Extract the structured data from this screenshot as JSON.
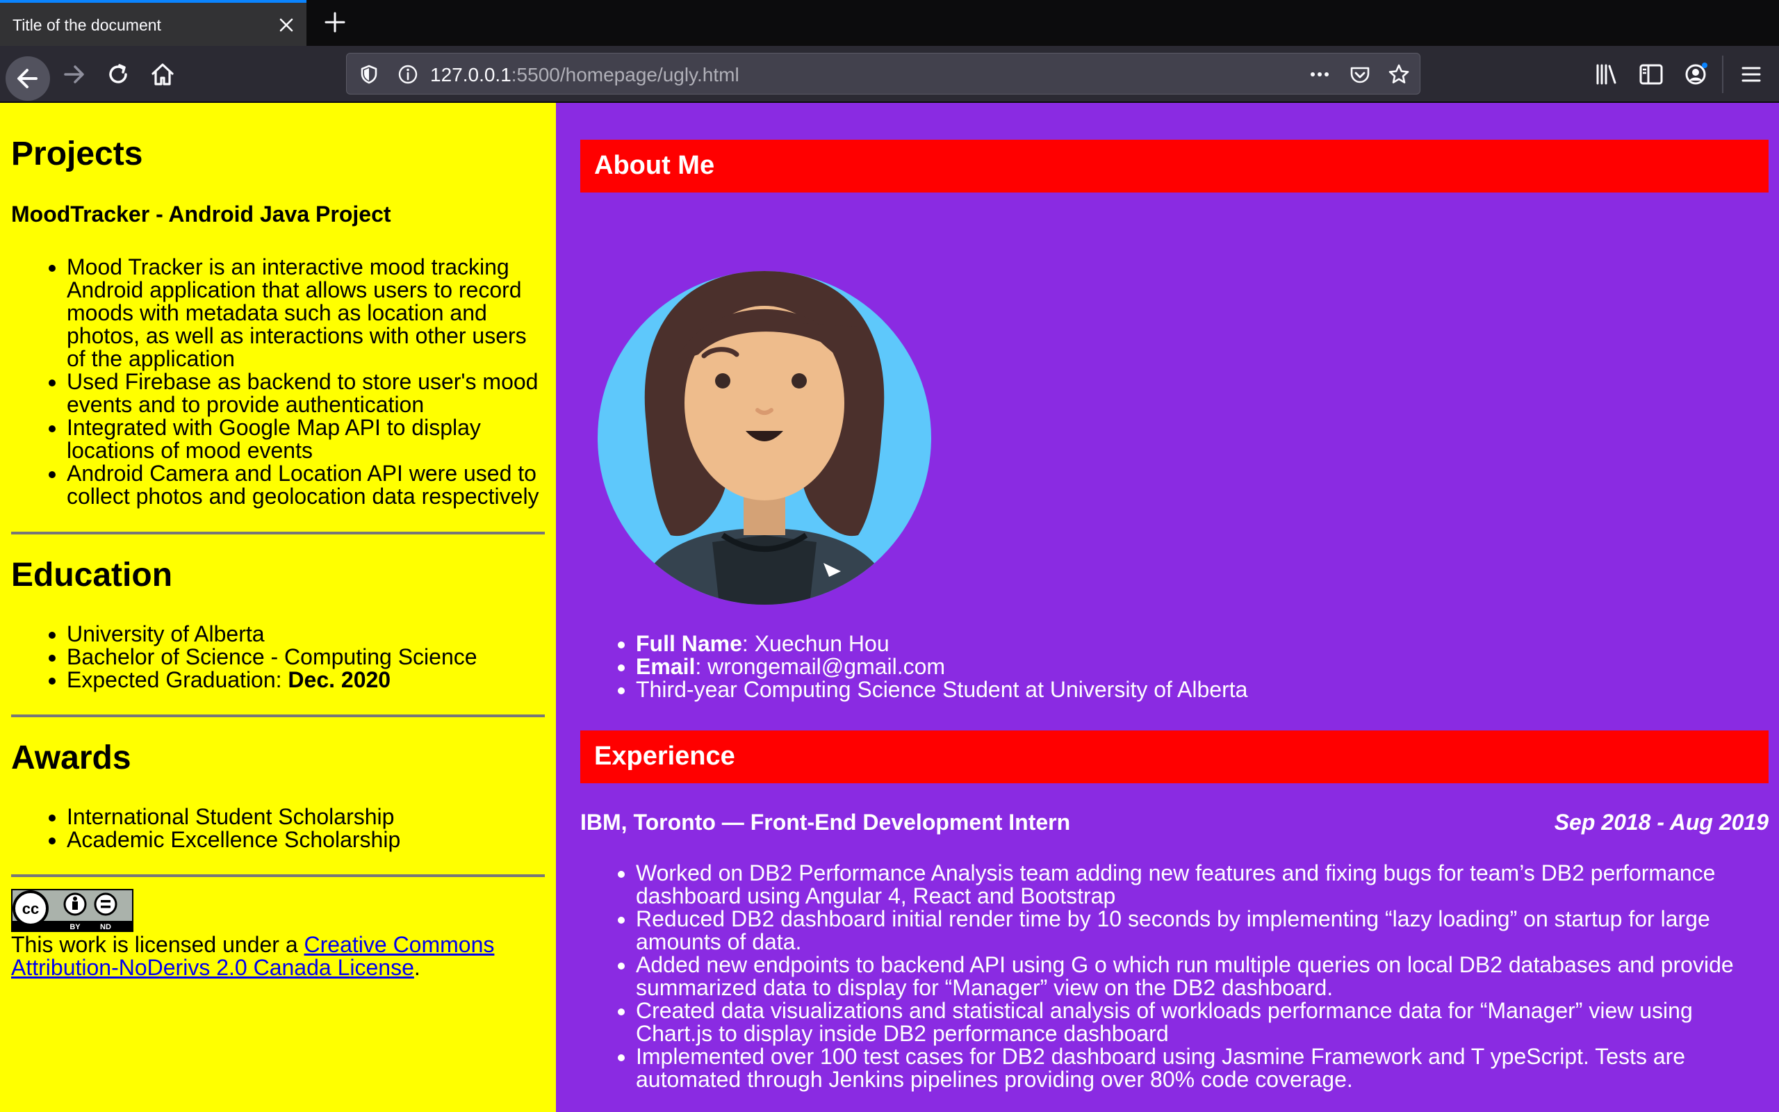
{
  "browser": {
    "tab_title": "Title of the document",
    "url_host": "127.0.0.1",
    "url_rest": ":5500/homepage/ugly.html"
  },
  "sidebar": {
    "projects": {
      "heading": "Projects",
      "project_title": "MoodTracker - Android Java Project",
      "items": [
        "Mood Tracker is an interactive mood tracking Android application that allows users to record moods with metadata such as location and photos, as well as interactions with other users of the application",
        "Used Firebase as backend to store user's mood events and to provide authentication",
        "Integrated with Google Map API to display locations of mood events",
        "Android Camera and Location API were used to collect photos and geolocation data respectively"
      ]
    },
    "education": {
      "heading": "Education",
      "items": [
        "University of Alberta",
        "Bachelor of Science - Computing Science"
      ],
      "graduation_label": "Expected Graduation: ",
      "graduation_value": "Dec. 2020"
    },
    "awards": {
      "heading": "Awards",
      "items": [
        "International Student Scholarship",
        "Academic Excellence Scholarship"
      ]
    },
    "license": {
      "badge_text_by": "BY",
      "badge_text_nd": "ND",
      "prefix": "This work is licensed under a ",
      "link_text": "Creative Commons Attribution-NoDerivs 2.0 Canada License",
      "suffix": "."
    }
  },
  "main": {
    "about": {
      "heading": "About Me",
      "full_name_label": "Full Name",
      "full_name_value": ": Xuechun Hou",
      "email_label": "Email",
      "email_value": ": wrongemail@gmail.com",
      "status": "Third-year Computing Science Student at University of Alberta"
    },
    "experience": {
      "heading": "Experience",
      "job_title": "IBM, Toronto — Front-End Development Intern",
      "job_dates": "Sep 2018 - Aug 2019",
      "items": [
        "Worked on DB2 Performance Analysis team adding new features and fixing bugs for team’s DB2 performance dashboard using Angular 4, React and Bootstrap",
        "Reduced DB2 dashboard initial render time by 10 seconds by implementing “lazy loading” on startup for large amounts of data.",
        "Added new endpoints to backend API using G o which run multiple queries on local DB2 databases and provide summarized data to display for “Manager” view on the DB2 dashboard.",
        "Created data visualizations and statistical analysis of workloads performance data for “Manager” view using Chart.js to display inside DB2 performance dashboard",
        "Implemented over 100 test cases for DB2 dashboard using Jasmine Framework and T ypeScript. Tests are automated through Jenkins pipelines providing over 80% code coverage."
      ]
    }
  },
  "colors": {
    "sidebar_bg": "#ffff00",
    "main_bg": "#8a2be2",
    "section_bar": "#ff0000"
  },
  "icons": [
    "close-icon",
    "plus-icon",
    "back-arrow-icon",
    "forward-arrow-icon",
    "reload-icon",
    "home-icon",
    "shield-icon",
    "info-icon",
    "more-dots-icon",
    "pocket-icon",
    "star-icon",
    "library-icon",
    "sidebar-icon",
    "account-icon",
    "hamburger-menu-icon"
  ]
}
